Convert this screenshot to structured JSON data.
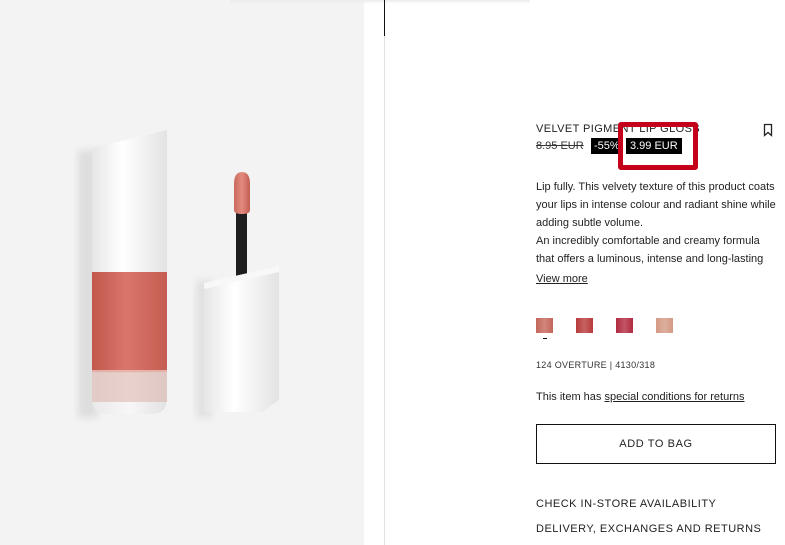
{
  "product": {
    "title": "VELVET PIGMENT LIP GLOSS",
    "old_price": "8.95 EUR",
    "discount": "-55%",
    "new_price": "3.99 EUR",
    "description": [
      "Lip fully. This velvety texture of this product coats your lips in intense colour and radiant shine while adding subtle volume.",
      "An incredibly comfortable and creamy formula that offers a luminous, intense and long-lasting"
    ],
    "view_more": "View more",
    "swatches": [
      {
        "name": "swatch-1",
        "color": "#c4665a"
      },
      {
        "name": "swatch-2",
        "color": "#b83a3a"
      },
      {
        "name": "swatch-3",
        "color": "#b22a40"
      },
      {
        "name": "swatch-4",
        "color": "#d49a84"
      }
    ],
    "reference": "124 OVERTURE | 4130/318",
    "returns_text": "This item has",
    "returns_link": "special conditions for returns",
    "add_to_bag": "ADD TO BAG",
    "links": [
      "CHECK IN-STORE AVAILABILITY",
      "DELIVERY, EXCHANGES AND RETURNS"
    ]
  },
  "colors": {
    "highlight": "#c4001a",
    "lip_color": "#d2685c"
  }
}
